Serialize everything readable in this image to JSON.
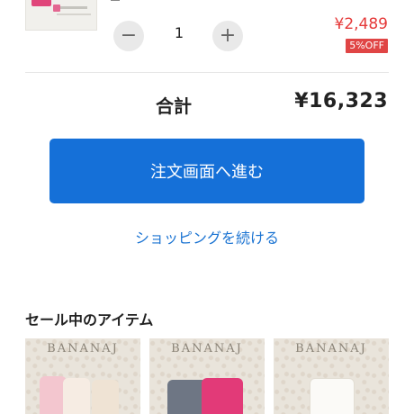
{
  "cart_item": {
    "quantity": "1",
    "minus_symbol": "−",
    "plus_symbol": "+",
    "price": "¥2,489",
    "discount_badge": "5%OFF"
  },
  "summary": {
    "total_label": "合計",
    "total_value": "¥16,323"
  },
  "actions": {
    "checkout_label": "注文画面へ進む",
    "continue_label": "ショッピングを続ける"
  },
  "sale": {
    "heading": "セール中のアイテム",
    "items": [
      {
        "brand": "BANANAJ"
      },
      {
        "brand": "BANANAJ"
      },
      {
        "brand": "BANANAJ"
      }
    ]
  },
  "colors": {
    "price_red": "#e53a3a",
    "badge_red": "#e04545",
    "primary_blue": "#1570d8",
    "link_blue": "#1a73d2"
  }
}
